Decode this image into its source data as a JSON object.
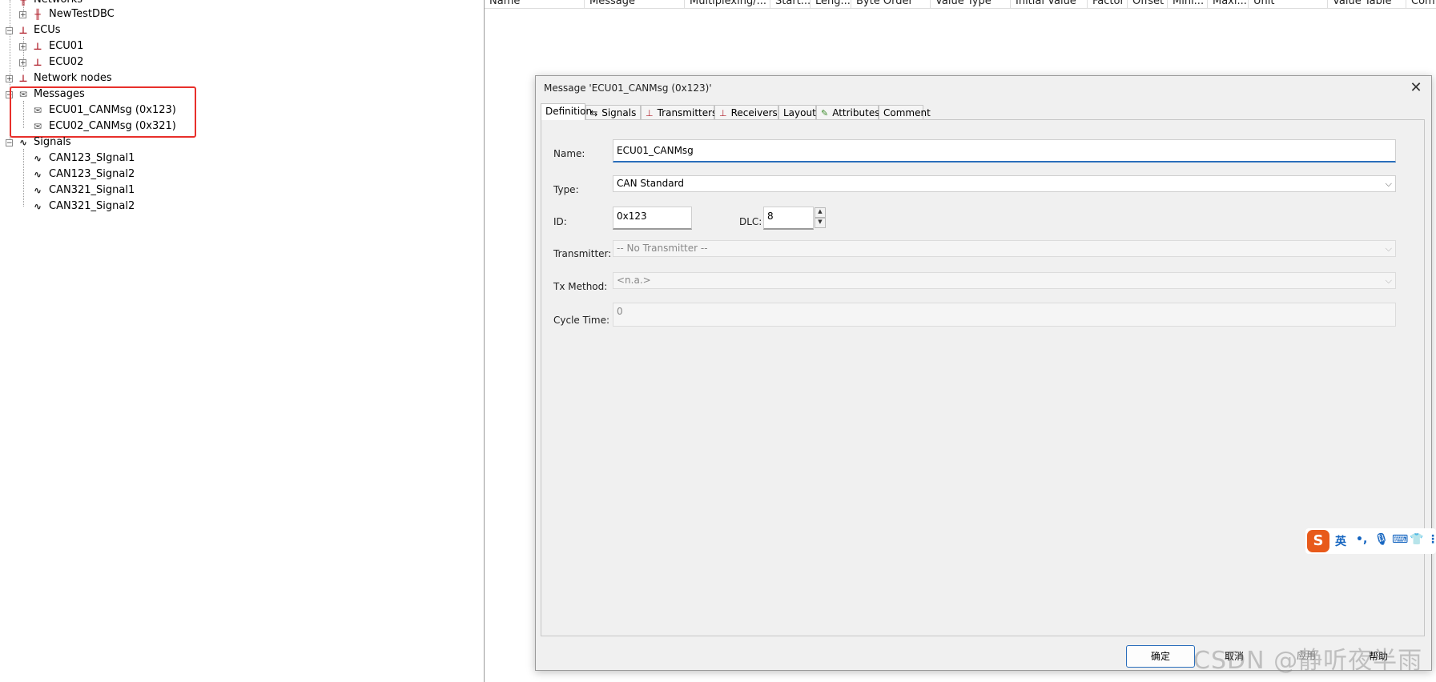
{
  "tree": {
    "networks_label": "Networks",
    "network_item": "NewTestDBC",
    "ecus_label": "ECUs",
    "ecu_items": [
      "ECU01",
      "ECU02"
    ],
    "network_nodes_label": "Network nodes",
    "messages_label": "Messages",
    "message_items": [
      "ECU01_CANMsg (0x123)",
      "ECU02_CANMsg (0x321)"
    ],
    "signals_label": "Signals",
    "signal_items": [
      "CAN123_SIgnal1",
      "CAN123_Signal2",
      "CAN321_Signal1",
      "CAN321_Signal2"
    ]
  },
  "columns": [
    "Name",
    "Message",
    "Multiplexing/...",
    "Start...",
    "Leng...",
    "Byte Order",
    "Value Type",
    "Initial Value",
    "Factor",
    "Offset",
    "Mini...",
    "Maxi...",
    "Unit",
    "Value Table",
    "Com"
  ],
  "dialog": {
    "title": "Message 'ECU01_CANMsg (0x123)'",
    "tabs": [
      "Definition",
      "Signals",
      "Transmitters",
      "Receivers",
      "Layout",
      "Attributes",
      "Comment"
    ],
    "form": {
      "name_label": "Name:",
      "name_value": "ECU01_CANMsg",
      "type_label": "Type:",
      "type_value": "CAN Standard",
      "id_label": "ID:",
      "id_value": "0x123",
      "dlc_label": "DLC:",
      "dlc_value": "8",
      "transmitter_label": "Transmitter:",
      "transmitter_value": "-- No Transmitter --",
      "txmethod_label": "Tx Method:",
      "txmethod_value": "<n.a.>",
      "cycletime_label": "Cycle Time:",
      "cycletime_value": "0"
    },
    "buttons": {
      "ok": "确定",
      "cancel": "取消",
      "apply": "应用",
      "help": "帮助"
    }
  },
  "ime": {
    "lang": "英"
  },
  "watermark": "CSDN @静听夜半雨",
  "colors": {
    "accent": "#2a6ebb",
    "highlight": "#e8302b",
    "ecu_icon": "#b01e2a"
  }
}
